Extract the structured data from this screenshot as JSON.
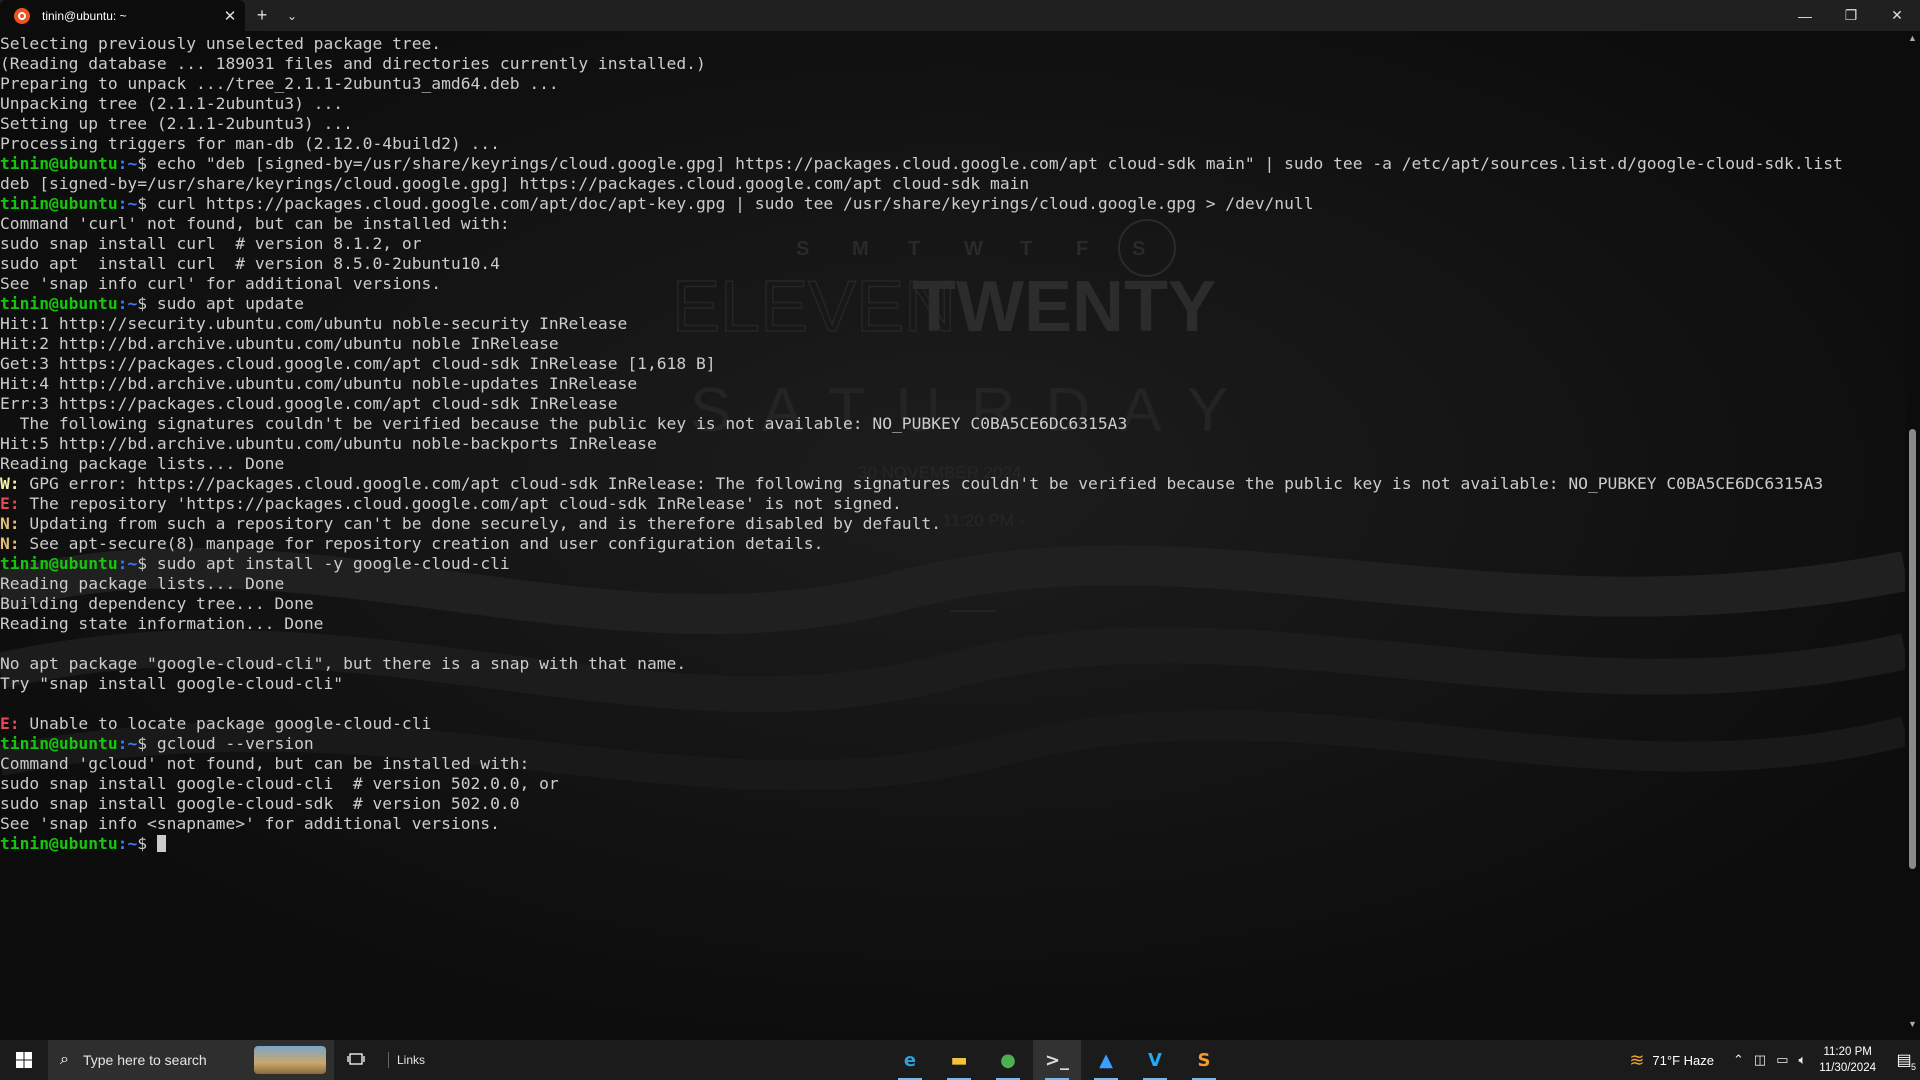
{
  "window": {
    "tab_title": "tinin@ubuntu: ~",
    "new_tab_glyph": "+",
    "dropdown_glyph": "⌄",
    "close_tab_glyph": "✕",
    "minimize_glyph": "—",
    "maximize_glyph": "❐",
    "close_glyph": "✕"
  },
  "terminal": {
    "prompt_user": "tinin@ubuntu",
    "prompt_path": ":~",
    "prompt_suffix": "$ ",
    "lines": [
      {
        "type": "out",
        "text": "Selecting previously unselected package tree."
      },
      {
        "type": "out",
        "text": "(Reading database ... 189031 files and directories currently installed.)"
      },
      {
        "type": "out",
        "text": "Preparing to unpack .../tree_2.1.1-2ubuntu3_amd64.deb ..."
      },
      {
        "type": "out",
        "text": "Unpacking tree (2.1.1-2ubuntu3) ..."
      },
      {
        "type": "out",
        "text": "Setting up tree (2.1.1-2ubuntu3) ..."
      },
      {
        "type": "out",
        "text": "Processing triggers for man-db (2.12.0-4build2) ..."
      },
      {
        "type": "cmd",
        "text": "echo \"deb [signed-by=/usr/share/keyrings/cloud.google.gpg] https://packages.cloud.google.com/apt cloud-sdk main\" | sudo tee -a /etc/apt/sources.list.d/google-cloud-sdk.list"
      },
      {
        "type": "out",
        "text": "deb [signed-by=/usr/share/keyrings/cloud.google.gpg] https://packages.cloud.google.com/apt cloud-sdk main"
      },
      {
        "type": "cmd",
        "text": "curl https://packages.cloud.google.com/apt/doc/apt-key.gpg | sudo tee /usr/share/keyrings/cloud.google.gpg > /dev/null"
      },
      {
        "type": "out",
        "text": "Command 'curl' not found, but can be installed with:"
      },
      {
        "type": "out",
        "text": "sudo snap install curl  # version 8.1.2, or"
      },
      {
        "type": "out",
        "text": "sudo apt  install curl  # version 8.5.0-2ubuntu10.4"
      },
      {
        "type": "out",
        "text": "See 'snap info curl' for additional versions."
      },
      {
        "type": "cmd",
        "text": "sudo apt update"
      },
      {
        "type": "out",
        "text": "Hit:1 http://security.ubuntu.com/ubuntu noble-security InRelease"
      },
      {
        "type": "out",
        "text": "Hit:2 http://bd.archive.ubuntu.com/ubuntu noble InRelease"
      },
      {
        "type": "out",
        "text": "Get:3 https://packages.cloud.google.com/apt cloud-sdk InRelease [1,618 B]"
      },
      {
        "type": "out",
        "text": "Hit:4 http://bd.archive.ubuntu.com/ubuntu noble-updates InRelease"
      },
      {
        "type": "out",
        "text": "Err:3 https://packages.cloud.google.com/apt cloud-sdk InRelease"
      },
      {
        "type": "out",
        "text": "  The following signatures couldn't be verified because the public key is not available: NO_PUBKEY C0BA5CE6DC6315A3"
      },
      {
        "type": "out",
        "text": "Hit:5 http://bd.archive.ubuntu.com/ubuntu noble-backports InRelease"
      },
      {
        "type": "out",
        "text": "Reading package lists... Done"
      },
      {
        "type": "warn",
        "prefix": "W:",
        "text": " GPG error: https://packages.cloud.google.com/apt cloud-sdk InRelease: The following signatures couldn't be verified because the public key is not available: NO_PUBKEY C0BA5CE6DC6315A3"
      },
      {
        "type": "err",
        "prefix": "E:",
        "text": " The repository 'https://packages.cloud.google.com/apt cloud-sdk InRelease' is not signed."
      },
      {
        "type": "note",
        "prefix": "N:",
        "text": " Updating from such a repository can't be done securely, and is therefore disabled by default."
      },
      {
        "type": "note",
        "prefix": "N:",
        "text": " See apt-secure(8) manpage for repository creation and user configuration details."
      },
      {
        "type": "cmd",
        "text": "sudo apt install -y google-cloud-cli"
      },
      {
        "type": "out",
        "text": "Reading package lists... Done"
      },
      {
        "type": "out",
        "text": "Building dependency tree... Done"
      },
      {
        "type": "out",
        "text": "Reading state information... Done"
      },
      {
        "type": "out",
        "text": ""
      },
      {
        "type": "out",
        "text": "No apt package \"google-cloud-cli\", but there is a snap with that name."
      },
      {
        "type": "out",
        "text": "Try \"snap install google-cloud-cli\""
      },
      {
        "type": "out",
        "text": ""
      },
      {
        "type": "err",
        "prefix": "E:",
        "text": " Unable to locate package google-cloud-cli"
      },
      {
        "type": "cmd",
        "text": "gcloud --version"
      },
      {
        "type": "out",
        "text": "Command 'gcloud' not found, but can be installed with:"
      },
      {
        "type": "out",
        "text": "sudo snap install google-cloud-cli  # version 502.0.0, or"
      },
      {
        "type": "out",
        "text": "sudo snap install google-cloud-sdk  # version 502.0.0"
      },
      {
        "type": "out",
        "text": "See 'snap info <snapname>' for additional versions."
      },
      {
        "type": "prompt",
        "text": ""
      }
    ]
  },
  "wallpaper": {
    "weekdays": [
      "S",
      "M",
      "T",
      "W",
      "T",
      "F",
      "S"
    ],
    "time_light": "ELEVEN",
    "time_bold": "TWENTY",
    "day": "SATURDAY",
    "date": "30 NOVEMBER 2024",
    "time_small": "- 11:20 PM -"
  },
  "taskbar": {
    "search_placeholder": "Type here to search",
    "links_label": "Links",
    "apps": [
      {
        "name": "edge-icon",
        "glyph": "e",
        "color": "#2d9fd9",
        "active": false
      },
      {
        "name": "file-explorer-icon",
        "glyph": "▬",
        "color": "#f0c33c",
        "active": false
      },
      {
        "name": "chrome-icon",
        "glyph": "●",
        "color": "#4caf50",
        "active": false
      },
      {
        "name": "terminal-icon",
        "glyph": ">_",
        "color": "#dddddd",
        "active": true
      },
      {
        "name": "photos-icon",
        "glyph": "▲",
        "color": "#3aa0ff",
        "active": false
      },
      {
        "name": "vscode-icon",
        "glyph": "V",
        "color": "#23a8f2",
        "active": false
      },
      {
        "name": "sublime-icon",
        "glyph": "S",
        "color": "#f79a2b",
        "active": false
      }
    ],
    "weather": "71°F  Haze",
    "clock_time": "11:20 PM",
    "clock_date": "11/30/2024",
    "notification_count": "5"
  }
}
